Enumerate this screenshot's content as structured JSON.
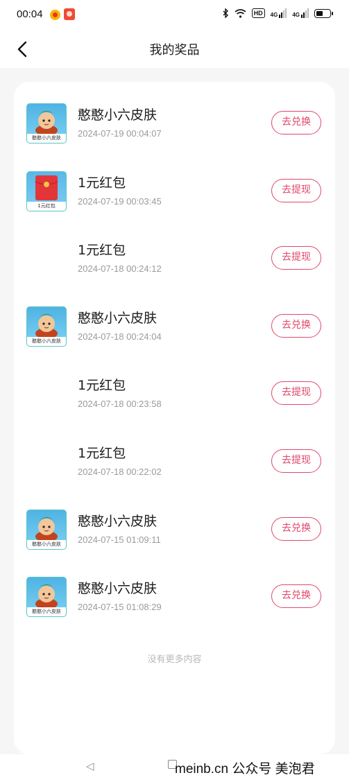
{
  "status_bar": {
    "time": "00:04",
    "hd_label": "HD",
    "net1": "4G",
    "net2": "4G"
  },
  "header": {
    "title": "我的奖品",
    "back_icon": "chevron-left-icon"
  },
  "prizes": [
    {
      "name": "憨憨小六皮肤",
      "time": "2024-07-19 00:04:07",
      "action": "去兑换",
      "thumb": "skin",
      "thumb_caption": "憨憨小六皮肤"
    },
    {
      "name": "1元红包",
      "time": "2024-07-19 00:03:45",
      "action": "去提现",
      "thumb": "redpacket",
      "thumb_caption": "1元红包"
    },
    {
      "name": "1元红包",
      "time": "2024-07-18 00:24:12",
      "action": "去提现",
      "thumb": "none"
    },
    {
      "name": "憨憨小六皮肤",
      "time": "2024-07-18 00:24:04",
      "action": "去兑换",
      "thumb": "skin",
      "thumb_caption": "憨憨小六皮肤"
    },
    {
      "name": "1元红包",
      "time": "2024-07-18 00:23:58",
      "action": "去提现",
      "thumb": "none"
    },
    {
      "name": "1元红包",
      "time": "2024-07-18 00:22:02",
      "action": "去提现",
      "thumb": "none"
    },
    {
      "name": "憨憨小六皮肤",
      "time": "2024-07-15 01:09:11",
      "action": "去兑换",
      "thumb": "skin",
      "thumb_caption": "憨憨小六皮肤"
    },
    {
      "name": "憨憨小六皮肤",
      "time": "2024-07-15 01:08:29",
      "action": "去兑换",
      "thumb": "skin",
      "thumb_caption": "憨憨小六皮肤"
    }
  ],
  "footer_note": "没有更多内容",
  "watermark": "meinb.cn 公众号 美泡君",
  "colors": {
    "accent": "#e0476a",
    "background": "#f6f6f6",
    "card": "#ffffff"
  }
}
